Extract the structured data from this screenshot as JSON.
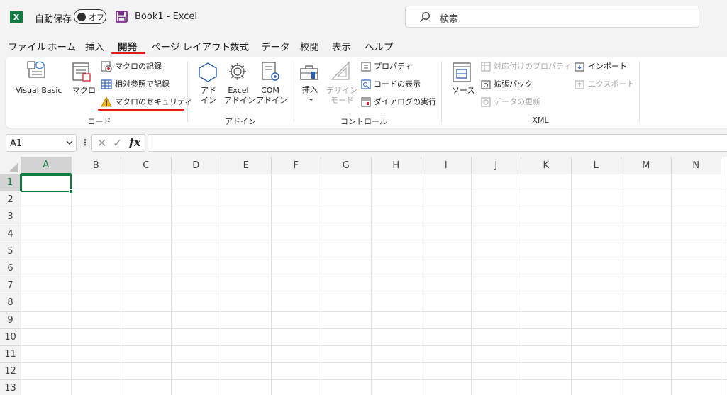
{
  "titlebar": {
    "app_logo": "X",
    "autosave_label": "自動保存",
    "autosave_state": "オフ",
    "doc_title": "Book1  -  Excel",
    "search_placeholder": "検索"
  },
  "menu": [
    {
      "label": "ファイル"
    },
    {
      "label": "ホーム"
    },
    {
      "label": "挿入"
    },
    {
      "label": "開発",
      "active": true
    },
    {
      "label": "ページ レイアウト"
    },
    {
      "label": "数式"
    },
    {
      "label": "データ"
    },
    {
      "label": "校閲"
    },
    {
      "label": "表示"
    },
    {
      "label": "ヘルプ"
    }
  ],
  "ribbon": {
    "code_group": {
      "title": "コード",
      "visual_basic": "Visual Basic",
      "macro": "マクロ",
      "record_macro": "マクロの記録",
      "relative_refs": "相対参照で記録",
      "macro_security": "マクロのセキュリティ"
    },
    "addins_group": {
      "title": "アドイン",
      "addins_1": "アド",
      "addins_2": "イン",
      "excel_addins_1": "Excel",
      "excel_addins_2": "アドイン",
      "com_addins_1": "COM",
      "com_addins_2": "アドイン"
    },
    "controls_group": {
      "title": "コントロール",
      "insert": "挿入",
      "insert_chevron": "⌄",
      "design_mode_1": "デザイン",
      "design_mode_2": "モード",
      "properties": "プロパティ",
      "view_code": "コードの表示",
      "run_dialog": "ダイアログの実行"
    },
    "xml_group": {
      "title": "XML",
      "source": "ソース",
      "map_properties": "対応付けのプロパティ",
      "expansion_packs": "拡張パック",
      "refresh_data": "データの更新",
      "import": "インポート",
      "export": "エクスポート"
    }
  },
  "formula_bar": {
    "name_box": "A1",
    "dots": "⋮",
    "cancel": "✕",
    "enter": "✓",
    "fx": "fx",
    "value": ""
  },
  "grid": {
    "columns": [
      "A",
      "B",
      "C",
      "D",
      "E",
      "F",
      "G",
      "H",
      "I",
      "J",
      "K",
      "L",
      "M",
      "N"
    ],
    "rows": [
      "1",
      "2",
      "3",
      "4",
      "5",
      "6",
      "7",
      "8",
      "9",
      "10",
      "11",
      "12",
      "13"
    ],
    "active_cell": "A1"
  },
  "colors": {
    "excel_green": "#107c41",
    "annotation_red": "#e21b1b",
    "warning_yellow": "#f2b70a"
  }
}
